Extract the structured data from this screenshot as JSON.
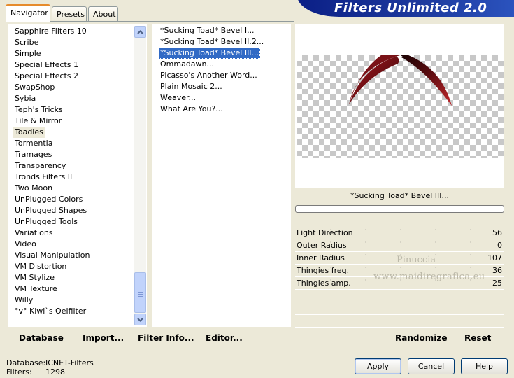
{
  "tabs": [
    {
      "label": "Navigator",
      "active": true
    },
    {
      "label": "Presets",
      "active": false
    },
    {
      "label": "About",
      "active": false
    }
  ],
  "banner": {
    "title": "Filters Unlimited 2.0"
  },
  "categories": {
    "items": [
      "Sapphire Filters 10",
      "Scribe",
      "Simple",
      "Special Effects 1",
      "Special Effects 2",
      "SwapShop",
      "Sybia",
      "Teph's Tricks",
      "Tile & Mirror",
      "Toadies",
      "Tormentia",
      "Tramages",
      "Transparency",
      "Tronds Filters II",
      "Two Moon",
      "UnPlugged Colors",
      "UnPlugged Shapes",
      "UnPlugged Tools",
      "Variations",
      "Video",
      "Visual Manipulation",
      "VM Distortion",
      "VM Stylize",
      "VM Texture",
      "Willy",
      "°v° Kiwi`s Oelfilter"
    ],
    "selected": "Toadies"
  },
  "filters": {
    "items": [
      "*Sucking Toad*  Bevel I...",
      "*Sucking Toad*  Bevel II.2...",
      "*Sucking Toad*  Bevel III...",
      "Ommadawn...",
      "Picasso's Another Word...",
      "Plain Mosaic 2...",
      "Weaver...",
      "What Are You?..."
    ],
    "selected": "*Sucking Toad*  Bevel III..."
  },
  "preview": {
    "filter_name": "*Sucking Toad*  Bevel III..."
  },
  "params": [
    {
      "label": "Light Direction",
      "value": "56"
    },
    {
      "label": "Outer Radius",
      "value": "0"
    },
    {
      "label": "Inner Radius",
      "value": "107"
    },
    {
      "label": "Thingies freq.",
      "value": "36"
    },
    {
      "label": "Thingies amp.",
      "value": "25"
    }
  ],
  "watermark": {
    "line1": "Pinuccia",
    "line2": "www.maidiregrafica.eu"
  },
  "bottom_links": {
    "database": {
      "u": "D",
      "rest": "atabase"
    },
    "import": {
      "u": "I",
      "rest": "mport..."
    },
    "filter_info": {
      "pre": "Filter ",
      "u": "I",
      "rest": "nfo..."
    },
    "editor": {
      "u": "E",
      "rest": "ditor..."
    },
    "randomize": "Randomize",
    "reset": "Reset"
  },
  "status": {
    "database_label": "Database:",
    "database_value": "ICNET-Filters",
    "filters_label": "Filters:",
    "filters_value": "1298"
  },
  "buttons": {
    "apply": "Apply",
    "cancel": "Cancel",
    "help": "Help"
  },
  "colors": {
    "banner": "#0b1f86",
    "selection": "#316ac5",
    "tab_highlight": "#e68b2c"
  }
}
